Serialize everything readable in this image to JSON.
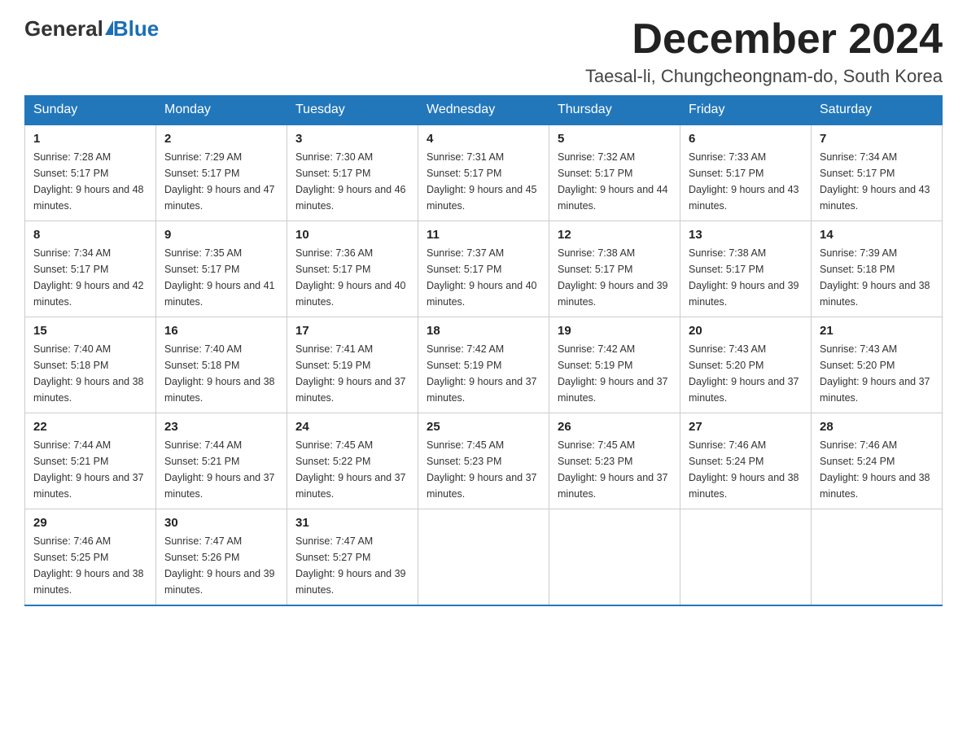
{
  "header": {
    "logo_general": "General",
    "logo_blue": "Blue",
    "month_title": "December 2024",
    "location": "Taesal-li, Chungcheongnam-do, South Korea"
  },
  "calendar": {
    "days_of_week": [
      "Sunday",
      "Monday",
      "Tuesday",
      "Wednesday",
      "Thursday",
      "Friday",
      "Saturday"
    ],
    "weeks": [
      [
        {
          "day": "1",
          "sunrise": "7:28 AM",
          "sunset": "5:17 PM",
          "daylight": "9 hours and 48 minutes."
        },
        {
          "day": "2",
          "sunrise": "7:29 AM",
          "sunset": "5:17 PM",
          "daylight": "9 hours and 47 minutes."
        },
        {
          "day": "3",
          "sunrise": "7:30 AM",
          "sunset": "5:17 PM",
          "daylight": "9 hours and 46 minutes."
        },
        {
          "day": "4",
          "sunrise": "7:31 AM",
          "sunset": "5:17 PM",
          "daylight": "9 hours and 45 minutes."
        },
        {
          "day": "5",
          "sunrise": "7:32 AM",
          "sunset": "5:17 PM",
          "daylight": "9 hours and 44 minutes."
        },
        {
          "day": "6",
          "sunrise": "7:33 AM",
          "sunset": "5:17 PM",
          "daylight": "9 hours and 43 minutes."
        },
        {
          "day": "7",
          "sunrise": "7:34 AM",
          "sunset": "5:17 PM",
          "daylight": "9 hours and 43 minutes."
        }
      ],
      [
        {
          "day": "8",
          "sunrise": "7:34 AM",
          "sunset": "5:17 PM",
          "daylight": "9 hours and 42 minutes."
        },
        {
          "day": "9",
          "sunrise": "7:35 AM",
          "sunset": "5:17 PM",
          "daylight": "9 hours and 41 minutes."
        },
        {
          "day": "10",
          "sunrise": "7:36 AM",
          "sunset": "5:17 PM",
          "daylight": "9 hours and 40 minutes."
        },
        {
          "day": "11",
          "sunrise": "7:37 AM",
          "sunset": "5:17 PM",
          "daylight": "9 hours and 40 minutes."
        },
        {
          "day": "12",
          "sunrise": "7:38 AM",
          "sunset": "5:17 PM",
          "daylight": "9 hours and 39 minutes."
        },
        {
          "day": "13",
          "sunrise": "7:38 AM",
          "sunset": "5:17 PM",
          "daylight": "9 hours and 39 minutes."
        },
        {
          "day": "14",
          "sunrise": "7:39 AM",
          "sunset": "5:18 PM",
          "daylight": "9 hours and 38 minutes."
        }
      ],
      [
        {
          "day": "15",
          "sunrise": "7:40 AM",
          "sunset": "5:18 PM",
          "daylight": "9 hours and 38 minutes."
        },
        {
          "day": "16",
          "sunrise": "7:40 AM",
          "sunset": "5:18 PM",
          "daylight": "9 hours and 38 minutes."
        },
        {
          "day": "17",
          "sunrise": "7:41 AM",
          "sunset": "5:19 PM",
          "daylight": "9 hours and 37 minutes."
        },
        {
          "day": "18",
          "sunrise": "7:42 AM",
          "sunset": "5:19 PM",
          "daylight": "9 hours and 37 minutes."
        },
        {
          "day": "19",
          "sunrise": "7:42 AM",
          "sunset": "5:19 PM",
          "daylight": "9 hours and 37 minutes."
        },
        {
          "day": "20",
          "sunrise": "7:43 AM",
          "sunset": "5:20 PM",
          "daylight": "9 hours and 37 minutes."
        },
        {
          "day": "21",
          "sunrise": "7:43 AM",
          "sunset": "5:20 PM",
          "daylight": "9 hours and 37 minutes."
        }
      ],
      [
        {
          "day": "22",
          "sunrise": "7:44 AM",
          "sunset": "5:21 PM",
          "daylight": "9 hours and 37 minutes."
        },
        {
          "day": "23",
          "sunrise": "7:44 AM",
          "sunset": "5:21 PM",
          "daylight": "9 hours and 37 minutes."
        },
        {
          "day": "24",
          "sunrise": "7:45 AM",
          "sunset": "5:22 PM",
          "daylight": "9 hours and 37 minutes."
        },
        {
          "day": "25",
          "sunrise": "7:45 AM",
          "sunset": "5:23 PM",
          "daylight": "9 hours and 37 minutes."
        },
        {
          "day": "26",
          "sunrise": "7:45 AM",
          "sunset": "5:23 PM",
          "daylight": "9 hours and 37 minutes."
        },
        {
          "day": "27",
          "sunrise": "7:46 AM",
          "sunset": "5:24 PM",
          "daylight": "9 hours and 38 minutes."
        },
        {
          "day": "28",
          "sunrise": "7:46 AM",
          "sunset": "5:24 PM",
          "daylight": "9 hours and 38 minutes."
        }
      ],
      [
        {
          "day": "29",
          "sunrise": "7:46 AM",
          "sunset": "5:25 PM",
          "daylight": "9 hours and 38 minutes."
        },
        {
          "day": "30",
          "sunrise": "7:47 AM",
          "sunset": "5:26 PM",
          "daylight": "9 hours and 39 minutes."
        },
        {
          "day": "31",
          "sunrise": "7:47 AM",
          "sunset": "5:27 PM",
          "daylight": "9 hours and 39 minutes."
        },
        null,
        null,
        null,
        null
      ]
    ]
  }
}
